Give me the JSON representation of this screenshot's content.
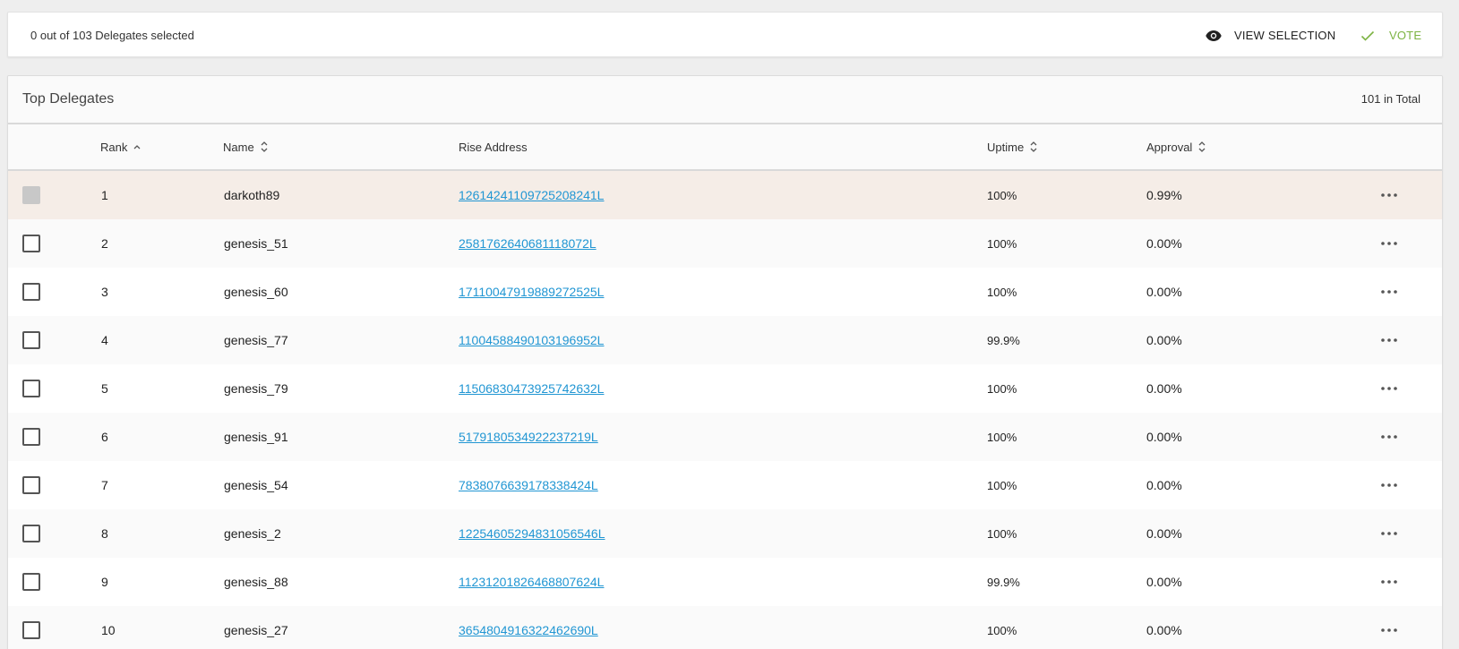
{
  "selection_bar": {
    "count_text": "0 out of 103 Delegates selected",
    "view_selection_label": "VIEW SELECTION",
    "vote_label": "VOTE",
    "vote_color": "#7cb342"
  },
  "card": {
    "title": "Top Delegates",
    "total": "101 in Total"
  },
  "table": {
    "headers": {
      "rank": "Rank",
      "name": "Name",
      "address": "Rise Address",
      "uptime": "Uptime",
      "approval": "Approval"
    },
    "sort": {
      "rank": "ascending",
      "name": "sortable",
      "uptime": "sortable",
      "approval": "sortable"
    },
    "link_color": "#2196d3",
    "highlight_color": "#f5ede7",
    "rows": [
      {
        "rank": "1",
        "name": "darkoth89",
        "address": "12614241109725208241L",
        "uptime": "100%",
        "approval": "0.99%",
        "checkbox_disabled": true
      },
      {
        "rank": "2",
        "name": "genesis_51",
        "address": "2581762640681118072L",
        "uptime": "100%",
        "approval": "0.00%",
        "checkbox_disabled": false
      },
      {
        "rank": "3",
        "name": "genesis_60",
        "address": "17110047919889272525L",
        "uptime": "100%",
        "approval": "0.00%",
        "checkbox_disabled": false
      },
      {
        "rank": "4",
        "name": "genesis_77",
        "address": "11004588490103196952L",
        "uptime": "99.9%",
        "approval": "0.00%",
        "checkbox_disabled": false
      },
      {
        "rank": "5",
        "name": "genesis_79",
        "address": "11506830473925742632L",
        "uptime": "100%",
        "approval": "0.00%",
        "checkbox_disabled": false
      },
      {
        "rank": "6",
        "name": "genesis_91",
        "address": "5179180534922237219L",
        "uptime": "100%",
        "approval": "0.00%",
        "checkbox_disabled": false
      },
      {
        "rank": "7",
        "name": "genesis_54",
        "address": "7838076639178338424L",
        "uptime": "100%",
        "approval": "0.00%",
        "checkbox_disabled": false
      },
      {
        "rank": "8",
        "name": "genesis_2",
        "address": "12254605294831056546L",
        "uptime": "100%",
        "approval": "0.00%",
        "checkbox_disabled": false
      },
      {
        "rank": "9",
        "name": "genesis_88",
        "address": "11231201826468807624L",
        "uptime": "99.9%",
        "approval": "0.00%",
        "checkbox_disabled": false
      },
      {
        "rank": "10",
        "name": "genesis_27",
        "address": "3654804916322462690L",
        "uptime": "100%",
        "approval": "0.00%",
        "checkbox_disabled": false
      }
    ]
  },
  "icons": {
    "view": "eye-icon",
    "vote": "check-icon",
    "sort_asc": "chevron-up-icon",
    "sort_both": "unfold-icon",
    "row_menu": "more-horizontal-icon"
  }
}
